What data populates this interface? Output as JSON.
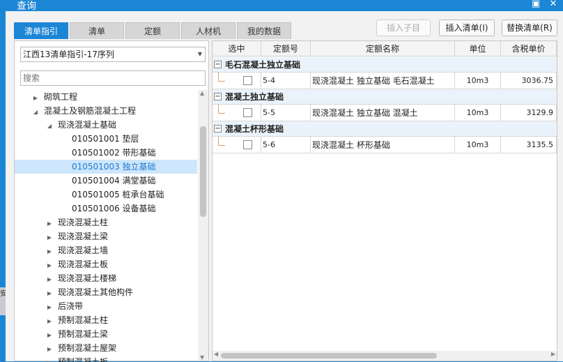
{
  "window": {
    "title": "查询",
    "min_glyph": "▣",
    "close_glyph": "✕"
  },
  "side_clip_text": "安",
  "tabs": [
    {
      "label": "清单指引"
    },
    {
      "label": "清单"
    },
    {
      "label": "定额"
    },
    {
      "label": "人材机"
    },
    {
      "label": "我的数据"
    }
  ],
  "toolbar": {
    "insert_child": "插入子目",
    "insert_list": "插入清单(I)",
    "replace_list": "替换清单(R)"
  },
  "left": {
    "combo_value": "江西13清单指引-17序列",
    "search_placeholder": "搜索",
    "tree": [
      {
        "label": "砌筑工程",
        "indent": 1,
        "state": "collapsed",
        "selected": false
      },
      {
        "label": "混凝土及钢筋混凝土工程",
        "indent": 1,
        "state": "expanded",
        "selected": false
      },
      {
        "label": "现浇混凝土基础",
        "indent": 2,
        "state": "expanded",
        "selected": false
      },
      {
        "label": "010501001  垫层",
        "indent": 3,
        "state": "leaf",
        "selected": false
      },
      {
        "label": "010501002  带形基础",
        "indent": 3,
        "state": "leaf",
        "selected": false
      },
      {
        "label": "010501003  独立基础",
        "indent": 3,
        "state": "leaf",
        "selected": true
      },
      {
        "label": "010501004  满堂基础",
        "indent": 3,
        "state": "leaf",
        "selected": false
      },
      {
        "label": "010501005  桩承台基础",
        "indent": 3,
        "state": "leaf",
        "selected": false
      },
      {
        "label": "010501006  设备基础",
        "indent": 3,
        "state": "leaf",
        "selected": false
      },
      {
        "label": "现浇混凝土柱",
        "indent": 2,
        "state": "collapsed",
        "selected": false
      },
      {
        "label": "现浇混凝土梁",
        "indent": 2,
        "state": "collapsed",
        "selected": false
      },
      {
        "label": "现浇混凝土墙",
        "indent": 2,
        "state": "collapsed",
        "selected": false
      },
      {
        "label": "现浇混凝土板",
        "indent": 2,
        "state": "collapsed",
        "selected": false
      },
      {
        "label": "现浇混凝土楼梯",
        "indent": 2,
        "state": "collapsed",
        "selected": false
      },
      {
        "label": "现浇混凝土其他构件",
        "indent": 2,
        "state": "collapsed",
        "selected": false
      },
      {
        "label": "后浇带",
        "indent": 2,
        "state": "collapsed",
        "selected": false
      },
      {
        "label": "预制混凝土柱",
        "indent": 2,
        "state": "collapsed",
        "selected": false
      },
      {
        "label": "预制混凝土梁",
        "indent": 2,
        "state": "collapsed",
        "selected": false
      },
      {
        "label": "预制混凝土屋架",
        "indent": 2,
        "state": "collapsed",
        "selected": false
      },
      {
        "label": "预制混凝土板",
        "indent": 2,
        "state": "collapsed",
        "selected": false
      }
    ]
  },
  "grid": {
    "columns": [
      "选中",
      "定额号",
      "定额名称",
      "单位",
      "含税单价"
    ],
    "groups": [
      {
        "title": "毛石混凝土独立基础",
        "rows": [
          {
            "checked": false,
            "code": "5-4",
            "name": "现浇混凝土 独立基础 毛石混凝土",
            "unit": "10m3",
            "price": "3036.75"
          }
        ]
      },
      {
        "title": "混凝土独立基础",
        "rows": [
          {
            "checked": false,
            "code": "5-5",
            "name": "现浇混凝土 独立基础 混凝土",
            "unit": "10m3",
            "price": "3129.9"
          }
        ]
      },
      {
        "title": "混凝土杯形基础",
        "rows": [
          {
            "checked": false,
            "code": "5-6",
            "name": "现浇混凝土 杯形基础",
            "unit": "10m3",
            "price": "3135.5"
          }
        ]
      }
    ]
  }
}
